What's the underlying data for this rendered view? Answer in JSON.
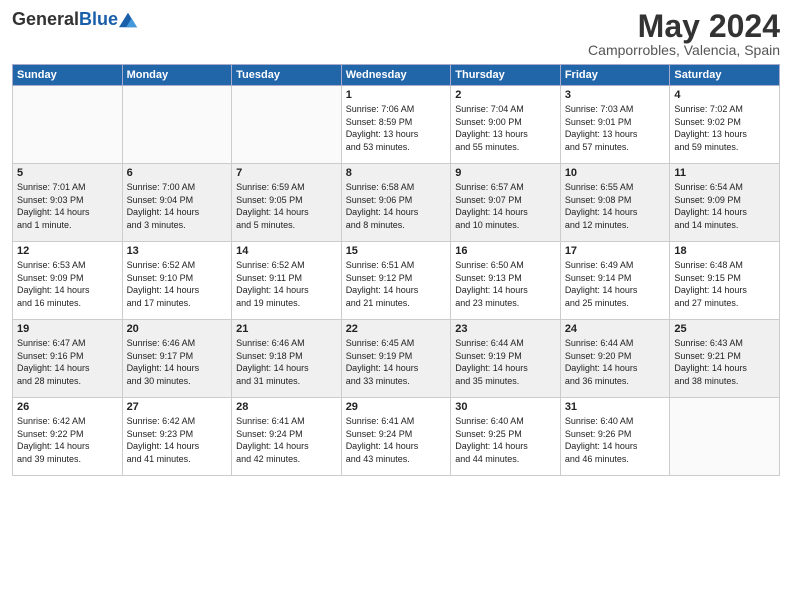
{
  "header": {
    "logo_general": "General",
    "logo_blue": "Blue",
    "month": "May 2024",
    "location": "Camporrobles, Valencia, Spain"
  },
  "weekdays": [
    "Sunday",
    "Monday",
    "Tuesday",
    "Wednesday",
    "Thursday",
    "Friday",
    "Saturday"
  ],
  "weeks": [
    [
      {
        "day": "",
        "info": ""
      },
      {
        "day": "",
        "info": ""
      },
      {
        "day": "",
        "info": ""
      },
      {
        "day": "1",
        "info": "Sunrise: 7:06 AM\nSunset: 8:59 PM\nDaylight: 13 hours\nand 53 minutes."
      },
      {
        "day": "2",
        "info": "Sunrise: 7:04 AM\nSunset: 9:00 PM\nDaylight: 13 hours\nand 55 minutes."
      },
      {
        "day": "3",
        "info": "Sunrise: 7:03 AM\nSunset: 9:01 PM\nDaylight: 13 hours\nand 57 minutes."
      },
      {
        "day": "4",
        "info": "Sunrise: 7:02 AM\nSunset: 9:02 PM\nDaylight: 13 hours\nand 59 minutes."
      }
    ],
    [
      {
        "day": "5",
        "info": "Sunrise: 7:01 AM\nSunset: 9:03 PM\nDaylight: 14 hours\nand 1 minute."
      },
      {
        "day": "6",
        "info": "Sunrise: 7:00 AM\nSunset: 9:04 PM\nDaylight: 14 hours\nand 3 minutes."
      },
      {
        "day": "7",
        "info": "Sunrise: 6:59 AM\nSunset: 9:05 PM\nDaylight: 14 hours\nand 5 minutes."
      },
      {
        "day": "8",
        "info": "Sunrise: 6:58 AM\nSunset: 9:06 PM\nDaylight: 14 hours\nand 8 minutes."
      },
      {
        "day": "9",
        "info": "Sunrise: 6:57 AM\nSunset: 9:07 PM\nDaylight: 14 hours\nand 10 minutes."
      },
      {
        "day": "10",
        "info": "Sunrise: 6:55 AM\nSunset: 9:08 PM\nDaylight: 14 hours\nand 12 minutes."
      },
      {
        "day": "11",
        "info": "Sunrise: 6:54 AM\nSunset: 9:09 PM\nDaylight: 14 hours\nand 14 minutes."
      }
    ],
    [
      {
        "day": "12",
        "info": "Sunrise: 6:53 AM\nSunset: 9:09 PM\nDaylight: 14 hours\nand 16 minutes."
      },
      {
        "day": "13",
        "info": "Sunrise: 6:52 AM\nSunset: 9:10 PM\nDaylight: 14 hours\nand 17 minutes."
      },
      {
        "day": "14",
        "info": "Sunrise: 6:52 AM\nSunset: 9:11 PM\nDaylight: 14 hours\nand 19 minutes."
      },
      {
        "day": "15",
        "info": "Sunrise: 6:51 AM\nSunset: 9:12 PM\nDaylight: 14 hours\nand 21 minutes."
      },
      {
        "day": "16",
        "info": "Sunrise: 6:50 AM\nSunset: 9:13 PM\nDaylight: 14 hours\nand 23 minutes."
      },
      {
        "day": "17",
        "info": "Sunrise: 6:49 AM\nSunset: 9:14 PM\nDaylight: 14 hours\nand 25 minutes."
      },
      {
        "day": "18",
        "info": "Sunrise: 6:48 AM\nSunset: 9:15 PM\nDaylight: 14 hours\nand 27 minutes."
      }
    ],
    [
      {
        "day": "19",
        "info": "Sunrise: 6:47 AM\nSunset: 9:16 PM\nDaylight: 14 hours\nand 28 minutes."
      },
      {
        "day": "20",
        "info": "Sunrise: 6:46 AM\nSunset: 9:17 PM\nDaylight: 14 hours\nand 30 minutes."
      },
      {
        "day": "21",
        "info": "Sunrise: 6:46 AM\nSunset: 9:18 PM\nDaylight: 14 hours\nand 31 minutes."
      },
      {
        "day": "22",
        "info": "Sunrise: 6:45 AM\nSunset: 9:19 PM\nDaylight: 14 hours\nand 33 minutes."
      },
      {
        "day": "23",
        "info": "Sunrise: 6:44 AM\nSunset: 9:19 PM\nDaylight: 14 hours\nand 35 minutes."
      },
      {
        "day": "24",
        "info": "Sunrise: 6:44 AM\nSunset: 9:20 PM\nDaylight: 14 hours\nand 36 minutes."
      },
      {
        "day": "25",
        "info": "Sunrise: 6:43 AM\nSunset: 9:21 PM\nDaylight: 14 hours\nand 38 minutes."
      }
    ],
    [
      {
        "day": "26",
        "info": "Sunrise: 6:42 AM\nSunset: 9:22 PM\nDaylight: 14 hours\nand 39 minutes."
      },
      {
        "day": "27",
        "info": "Sunrise: 6:42 AM\nSunset: 9:23 PM\nDaylight: 14 hours\nand 41 minutes."
      },
      {
        "day": "28",
        "info": "Sunrise: 6:41 AM\nSunset: 9:24 PM\nDaylight: 14 hours\nand 42 minutes."
      },
      {
        "day": "29",
        "info": "Sunrise: 6:41 AM\nSunset: 9:24 PM\nDaylight: 14 hours\nand 43 minutes."
      },
      {
        "day": "30",
        "info": "Sunrise: 6:40 AM\nSunset: 9:25 PM\nDaylight: 14 hours\nand 44 minutes."
      },
      {
        "day": "31",
        "info": "Sunrise: 6:40 AM\nSunset: 9:26 PM\nDaylight: 14 hours\nand 46 minutes."
      },
      {
        "day": "",
        "info": ""
      }
    ]
  ]
}
